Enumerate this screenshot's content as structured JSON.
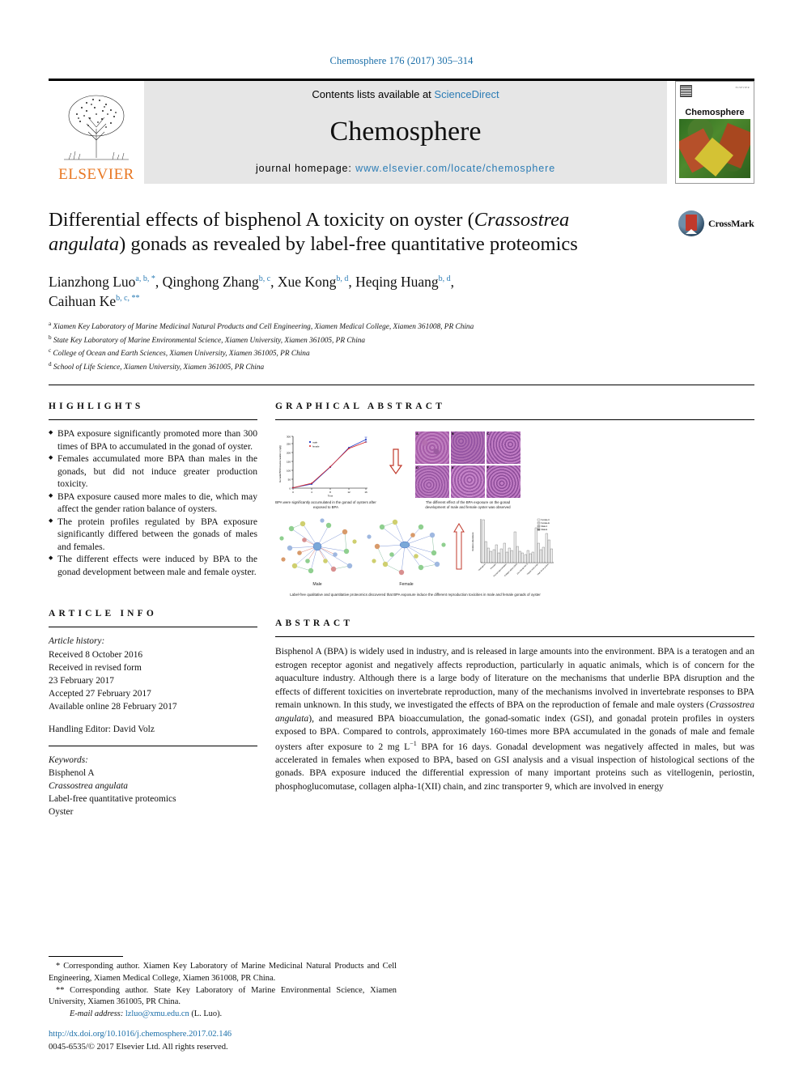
{
  "running_head": "Chemosphere 176 (2017) 305–314",
  "masthead": {
    "contents_prefix": "Contents lists available at ",
    "sciencedirect": "ScienceDirect",
    "journal_name": "Chemosphere",
    "homepage_label": "journal homepage: ",
    "homepage_url": "www.elsevier.com/locate/chemosphere",
    "publisher": "ELSEVIER",
    "cover_title": "Chemosphere",
    "cover_badge": "ELSEVIER"
  },
  "title": {
    "line1_a": "Differential effects of bisphenol A toxicity on oyster (",
    "line1_italic": "Crassostrea",
    "line2_italic": "angulata",
    "line2_b": ") gonads as revealed by label-free quantitative proteomics",
    "crossmark_label": "CrossMark"
  },
  "authors": [
    {
      "name": "Lianzhong Luo",
      "sup": "a, b, *"
    },
    {
      "name": "Qinghong Zhang",
      "sup": "b, c"
    },
    {
      "name": "Xue Kong",
      "sup": "b, d"
    },
    {
      "name": "Heqing Huang",
      "sup": "b, d"
    },
    {
      "name": "Caihuan Ke",
      "sup": "b, c, **"
    }
  ],
  "affiliations": [
    {
      "mark": "a",
      "text": "Xiamen Key Laboratory of Marine Medicinal Natural Products and Cell Engineering, Xiamen Medical College, Xiamen 361008, PR China"
    },
    {
      "mark": "b",
      "text": "State Key Laboratory of Marine Environmental Science, Xiamen University, Xiamen 361005, PR China"
    },
    {
      "mark": "c",
      "text": "College of Ocean and Earth Sciences, Xiamen University, Xiamen 361005, PR China"
    },
    {
      "mark": "d",
      "text": "School of Life Science, Xiamen University, Xiamen 361005, PR China"
    }
  ],
  "highlights": {
    "heading": "HIGHLIGHTS",
    "items": [
      "BPA exposure significantly promoted more than 300 times of BPA to accumulated in the gonad of oyster.",
      "Females accumulated more BPA than males in the gonads, but did not induce greater production toxicity.",
      "BPA exposure caused more males to die, which may affect the gender ration balance of oysters.",
      "The protein profiles regulated by BPA exposure significantly differed between the gonads of males and females.",
      "The different effects were induced by BPA to the gonad development between male and female oyster."
    ]
  },
  "graphical_abstract": {
    "heading": "GRAPHICAL ABSTRACT",
    "caption_left": "BPA were significantly accumulated in the gonad of oysters after exposed to BPA",
    "caption_right": "The different effect of the BPA exposure on the gonad development of male and female oyster was observed",
    "caption_bottom": "Label-free qualitative and quantitative proteomics discovered that BPA exposure induce the different reproduction toxicities in male and female gonads of oyster",
    "network_labels": [
      "Male",
      "Female"
    ],
    "histology_panel_labels": [
      "A",
      "B",
      "C",
      "D",
      "E",
      "F"
    ]
  },
  "chart_data": [
    {
      "type": "line",
      "title": "",
      "xlabel": "Time",
      "ylabel": "Gonadal BPA bioaccumulation (ng/g)",
      "x": [
        0,
        4,
        8,
        12,
        16
      ],
      "xticklabels": [
        "0",
        "4",
        "8",
        "12",
        "16"
      ],
      "yticklabels": [
        "0",
        "50",
        "100",
        "150",
        "200",
        "250",
        "300"
      ],
      "ylim": [
        0,
        300
      ],
      "series": [
        {
          "name": "male",
          "color": "#2b44c8",
          "values": [
            2,
            22,
            118,
            225,
            272
          ]
        },
        {
          "name": "female",
          "color": "#d81f1f",
          "values": [
            2,
            26,
            120,
            222,
            258
          ]
        }
      ],
      "legend_position": "top-left",
      "grid": false
    },
    {
      "type": "bar",
      "title": "",
      "xlabel": "",
      "ylabel": "Relative abundance",
      "categories": [
        "Vitellogenin",
        "Periostin",
        "Phosphoglucomutase",
        "Collagen alpha-1(XII)",
        "Zinc transporter 9",
        "Tubulin beta chain",
        "Heat shock protein"
      ],
      "series": [
        {
          "name": "Female-C",
          "values": [
            95,
            28,
            45,
            20,
            30,
            60,
            48
          ]
        },
        {
          "name": "Female-E",
          "values": [
            55,
            38,
            22,
            35,
            18,
            92,
            70
          ]
        },
        {
          "name": "Male-C",
          "values": [
            30,
            20,
            30,
            18,
            24,
            42,
            90
          ]
        },
        {
          "name": "Male-E",
          "values": [
            22,
            32,
            25,
            28,
            14,
            50,
            55
          ]
        }
      ],
      "ylim": [
        0,
        100
      ],
      "legend_position": "top-right",
      "grid": false
    }
  ],
  "article_info": {
    "heading": "ARTICLE INFO",
    "history_label": "Article history:",
    "history": [
      "Received 8 October 2016",
      "Received in revised form",
      "23 February 2017",
      "Accepted 27 February 2017",
      "Available online 28 February 2017"
    ],
    "handling_editor": "Handling Editor: David Volz",
    "keywords_label": "Keywords:",
    "keywords": [
      {
        "text": "Bisphenol A",
        "italic": false
      },
      {
        "text": "Crassostrea angulata",
        "italic": true
      },
      {
        "text": "Label-free quantitative proteomics",
        "italic": false
      },
      {
        "text": "Oyster",
        "italic": false
      }
    ]
  },
  "abstract": {
    "heading": "ABSTRACT",
    "part1": "Bisphenol A (BPA) is widely used in industry, and is released in large amounts into the environment. BPA is a teratogen and an estrogen receptor agonist and negatively affects reproduction, particularly in aquatic animals, which is of concern for the aquaculture industry. Although there is a large body of literature on the mechanisms that underlie BPA disruption and the effects of different toxicities on invertebrate reproduction, many of the mechanisms involved in invertebrate responses to BPA remain unknown. In this study, we investigated the effects of BPA on the reproduction of female and male oysters (",
    "species": "Crassostrea angulata",
    "part2": "), and measured BPA bioaccumulation, the gonad-somatic index (GSI), and gonadal protein profiles in oysters exposed to BPA. Compared to controls, approximately 160-times more BPA accumulated in the gonads of male and female oysters after exposure to 2 mg L",
    "sup": "−1",
    "part3": " BPA for 16 days. Gonadal development was negatively affected in males, but was accelerated in females when exposed to BPA, based on GSI analysis and a visual inspection of histological sections of the gonads. BPA exposure induced the differential expression of many important proteins such as vitellogenin, periostin, phosphoglucomutase, collagen alpha-1(XII) chain, and zinc transporter 9, which are involved in energy"
  },
  "footnotes": {
    "corr1": "* Corresponding author. Xiamen Key Laboratory of Marine Medicinal Natural Products and Cell Engineering, Xiamen Medical College, Xiamen 361008, PR China.",
    "corr2": "** Corresponding author. State Key Laboratory of Marine Environmental Science, Xiamen University, Xiamen 361005, PR China.",
    "email_label": "E-mail address:",
    "email": "lzluo@xmu.edu.cn",
    "email_owner": "(L. Luo)."
  },
  "doi": {
    "url": "http://dx.doi.org/10.1016/j.chemosphere.2017.02.146",
    "copyright": "0045-6535/© 2017 Elsevier Ltd. All rights reserved."
  }
}
